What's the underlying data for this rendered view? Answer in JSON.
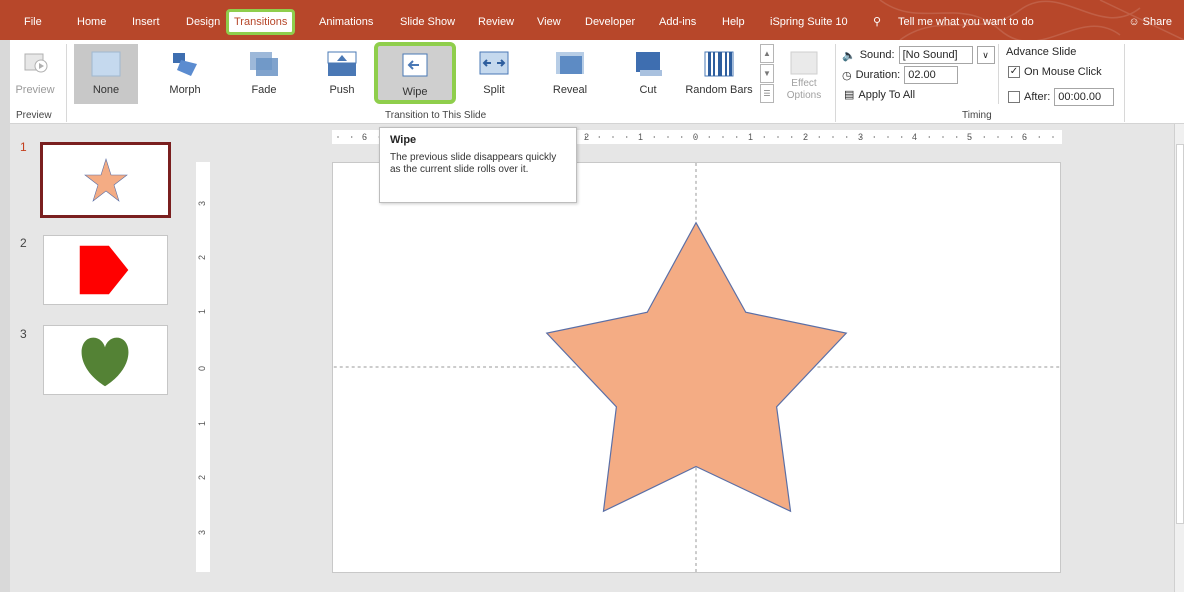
{
  "tabs": [
    {
      "label": "File",
      "active": false
    },
    {
      "label": "Home",
      "active": false
    },
    {
      "label": "Insert",
      "active": false
    },
    {
      "label": "Design",
      "active": false
    },
    {
      "label": "Transitions",
      "active": true
    },
    {
      "label": "Animations",
      "active": false
    },
    {
      "label": "Slide Show",
      "active": false
    },
    {
      "label": "Review",
      "active": false
    },
    {
      "label": "View",
      "active": false
    },
    {
      "label": "Developer",
      "active": false
    },
    {
      "label": "Add-ins",
      "active": false
    },
    {
      "label": "Help",
      "active": false
    },
    {
      "label": "iSpring Suite 10",
      "active": false
    }
  ],
  "tell_me": "Tell me what you want to do",
  "share": "Share",
  "ribbon": {
    "preview_label": "Preview",
    "preview_group": "Preview",
    "transitions": [
      {
        "label": "None",
        "icon": "none-transition-icon",
        "selected": true
      },
      {
        "label": "Morph",
        "icon": "morph-transition-icon",
        "selected": false
      },
      {
        "label": "Fade",
        "icon": "fade-transition-icon",
        "selected": false
      },
      {
        "label": "Push",
        "icon": "push-transition-icon",
        "selected": false
      },
      {
        "label": "Wipe",
        "icon": "wipe-transition-icon",
        "selected": false,
        "highlighted": true
      },
      {
        "label": "Split",
        "icon": "split-transition-icon",
        "selected": false
      },
      {
        "label": "Reveal",
        "icon": "reveal-transition-icon",
        "selected": false
      },
      {
        "label": "Cut",
        "icon": "cut-transition-icon",
        "selected": false
      },
      {
        "label": "Random Bars",
        "icon": "random-bars-transition-icon",
        "selected": false
      }
    ],
    "effect_options_line1": "Effect",
    "effect_options_line2": "Options",
    "transition_group": "Transition to This Slide",
    "timing": {
      "sound_label": "Sound:",
      "sound_value": "[No Sound]",
      "duration_label": "Duration:",
      "duration_value": "02.00",
      "apply_all": "Apply To All",
      "advance_title": "Advance Slide",
      "on_mouse_click": "On Mouse Click",
      "on_mouse_click_checked": true,
      "after_label": "After:",
      "after_value": "00:00.00",
      "after_checked": false,
      "group_label": "Timing"
    }
  },
  "tooltip": {
    "title": "Wipe",
    "body": "The previous slide disappears quickly as the current slide rolls over it."
  },
  "slides": [
    {
      "number": "1",
      "shape": "star",
      "color": "#f4ac84",
      "current": true
    },
    {
      "number": "2",
      "shape": "pentagon-arrow",
      "color": "#ff0000",
      "current": false
    },
    {
      "number": "3",
      "shape": "heart",
      "color": "#548235",
      "current": false
    }
  ],
  "ruler": {
    "h_ticks": [
      "6",
      "2",
      "1",
      "0",
      "1",
      "2",
      "3",
      "4",
      "5",
      "6"
    ],
    "v_ticks": [
      "3",
      "2",
      "1",
      "0",
      "1",
      "2",
      "3"
    ]
  },
  "colors": {
    "accent": "#b7472a",
    "highlight_outline": "#8fce4c",
    "star_fill": "#f4ac84",
    "star_stroke": "#5b6fa6"
  }
}
